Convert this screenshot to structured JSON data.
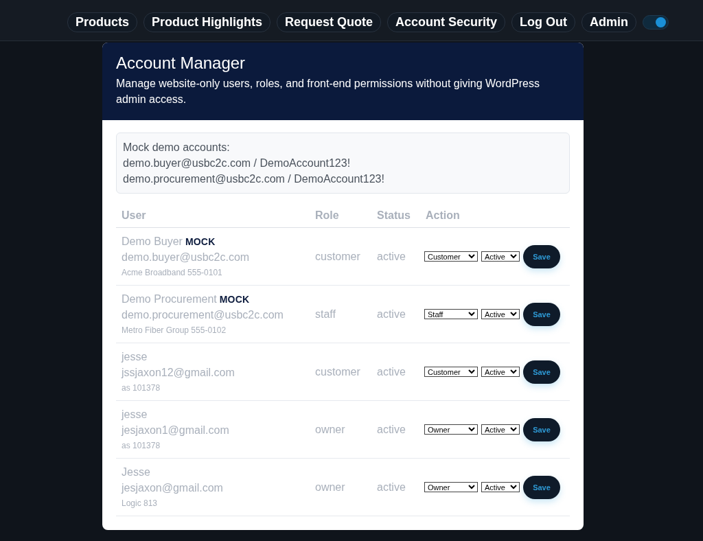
{
  "nav": {
    "items": [
      {
        "label": "Products"
      },
      {
        "label": "Product Highlights"
      },
      {
        "label": "Request Quote"
      },
      {
        "label": "Account Security"
      },
      {
        "label": "Log Out"
      },
      {
        "label": "Admin"
      }
    ],
    "theme_toggle": {
      "on": true
    }
  },
  "account_manager": {
    "title": "Account Manager",
    "description": "Manage website-only users, roles, and front-end permissions without giving WordPress admin access.",
    "demo_notice": [
      "Mock demo accounts:",
      "demo.buyer@usbc2c.com / DemoAccount123!",
      "demo.procurement@usbc2c.com / DemoAccount123!"
    ],
    "table": {
      "columns": [
        "User",
        "Role",
        "Status",
        "Action"
      ],
      "rows": [
        {
          "name": "Demo Buyer",
          "tag": "MOCK",
          "email": "demo.buyer@usbc2c.com",
          "note": "Acme Broadband 555-0101",
          "role": "customer",
          "status": "active",
          "role_choice": "Customer",
          "status_choice": "Active",
          "action": "Save"
        },
        {
          "name": "Demo Procurement",
          "tag": "MOCK",
          "email": "demo.procurement@usbc2c.com",
          "note": "Metro Fiber Group 555-0102",
          "role": "staff",
          "status": "active",
          "role_choice": "Staff",
          "status_choice": "Active",
          "action": "Save"
        },
        {
          "name": "jesse",
          "email": "jssjaxon12@gmail.com",
          "note": "as 101378",
          "role": "customer",
          "status": "active",
          "role_choice": "Customer",
          "status_choice": "Active",
          "action": "Save"
        },
        {
          "name": "jesse",
          "email": "jesjaxon1@gmail.com",
          "note": "as 101378",
          "role": "owner",
          "status": "active",
          "role_choice": "Owner",
          "status_choice": "Active",
          "action": "Save"
        },
        {
          "name": "Jesse",
          "email": "jesjaxon@gmail.com",
          "note": "Logic 813",
          "role": "owner",
          "status": "active",
          "role_choice": "Owner",
          "status_choice": "Active",
          "action": "Save"
        }
      ]
    }
  }
}
